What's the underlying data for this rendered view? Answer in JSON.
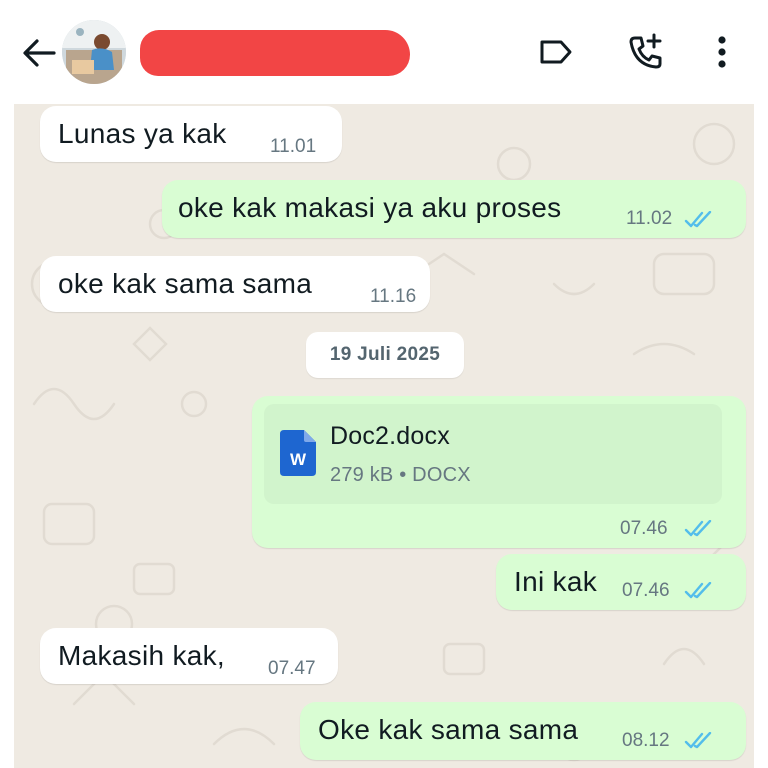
{
  "header": {
    "contact_name": "",
    "icons": [
      "back-arrow-icon",
      "label-icon",
      "add-call-icon",
      "more-vertical-icon"
    ]
  },
  "colors": {
    "incoming_bubble": "#ffffff",
    "outgoing_bubble": "#d9fdd3",
    "chat_background": "#efeae2",
    "read_ticks": "#53bdeb",
    "redaction": "#f24545"
  },
  "messages": [
    {
      "direction": "in",
      "text": "Lunas ya kak",
      "time": "11.01"
    },
    {
      "direction": "out",
      "text": "oke kak makasi ya aku proses",
      "time": "11.02",
      "status": "read"
    },
    {
      "direction": "in",
      "text": "oke kak sama sama",
      "time": "11.16"
    },
    {
      "direction": "out",
      "type": "document",
      "file_name": "Doc2.docx",
      "file_meta": "279 kB • DOCX",
      "file_icon_letter": "W",
      "time": "07.46",
      "status": "read"
    },
    {
      "direction": "out",
      "text": "Ini kak",
      "time": "07.46",
      "status": "read"
    },
    {
      "direction": "in",
      "text": "Makasih kak,",
      "time": "07.47"
    },
    {
      "direction": "out",
      "text": "Oke kak sama sama",
      "time": "08.12",
      "status": "read"
    }
  ],
  "date_divider": "19 Juli 2025"
}
